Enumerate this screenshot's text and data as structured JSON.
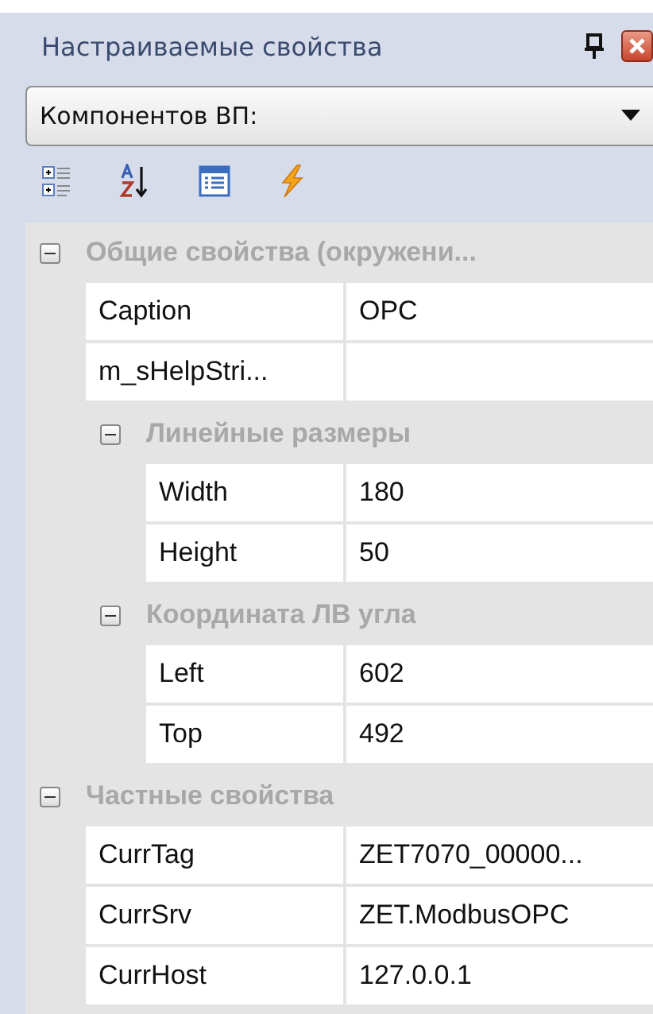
{
  "panel": {
    "title": "Настраиваемые свойства"
  },
  "selector": {
    "value": "Компонентов ВП:"
  },
  "toolbar": [
    {
      "kind": "categorized"
    },
    {
      "kind": "alphabetical"
    },
    {
      "kind": "pages"
    },
    {
      "kind": "events"
    }
  ],
  "grid": {
    "items": [
      {
        "kind": "category",
        "name": "Общие свойства (окружени...",
        "expanded": true,
        "children": [
          {
            "kind": "property",
            "name": "Caption",
            "value": "OPC"
          },
          {
            "kind": "property",
            "name": "m_sHelpStri..."
          },
          {
            "kind": "category",
            "name": "Линейные размеры",
            "expanded": true,
            "children": [
              {
                "kind": "property",
                "name": "Width",
                "value": "180"
              },
              {
                "kind": "property",
                "name": "Height",
                "value": "50"
              }
            ]
          },
          {
            "kind": "category",
            "name": "Координата ЛВ угла",
            "expanded": true,
            "children": [
              {
                "kind": "property",
                "name": "Left",
                "value": "602"
              },
              {
                "kind": "property",
                "name": "Top",
                "value": "492"
              }
            ]
          }
        ]
      },
      {
        "kind": "category",
        "name": "Частные свойства",
        "expanded": true,
        "children": [
          {
            "kind": "property",
            "name": "CurrTag",
            "value": "ZET7070_00000..."
          },
          {
            "kind": "property",
            "name": "CurrSrv",
            "value": "ZET.ModbusOPC"
          },
          {
            "kind": "property",
            "name": "CurrHost",
            "value": "127.0.0.1"
          }
        ]
      }
    ]
  }
}
